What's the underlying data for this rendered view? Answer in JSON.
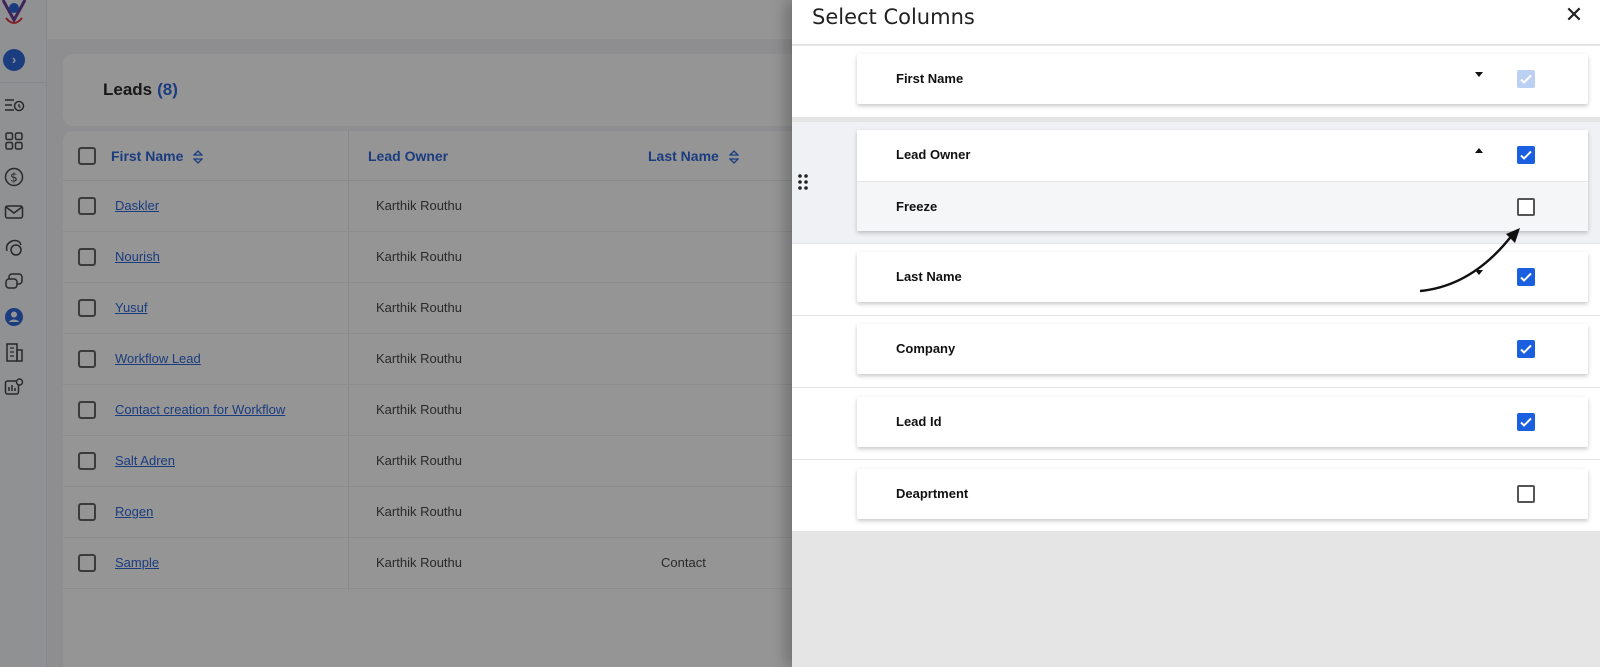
{
  "leads": {
    "title": "Leads",
    "count": "(8)",
    "columns": [
      "First Name",
      "Lead Owner",
      "Last Name"
    ],
    "rows": [
      {
        "first_name": "Daskler",
        "owner": "Karthik Routhu",
        "last_name": ""
      },
      {
        "first_name": "Nourish",
        "owner": "Karthik Routhu",
        "last_name": ""
      },
      {
        "first_name": "Yusuf",
        "owner": "Karthik Routhu",
        "last_name": ""
      },
      {
        "first_name": "Workflow Lead",
        "owner": "Karthik Routhu",
        "last_name": ""
      },
      {
        "first_name": "Contact creation for Workflow",
        "owner": "Karthik Routhu",
        "last_name": ""
      },
      {
        "first_name": "Salt Adren",
        "owner": "Karthik Routhu",
        "last_name": ""
      },
      {
        "first_name": "Rogen",
        "owner": "Karthik Routhu",
        "last_name": ""
      },
      {
        "first_name": "Sample",
        "owner": "Karthik Routhu",
        "last_name": "Contact"
      }
    ]
  },
  "panel": {
    "title": "Select Columns",
    "close": "✕",
    "items": [
      {
        "label": "First Name",
        "caret": "down",
        "checked": "disabled"
      },
      {
        "label": "Lead Owner",
        "caret": "up",
        "checked": "on",
        "sub_label": "Freeze",
        "sub_checked": "off"
      },
      {
        "label": "Last Name",
        "caret": "down",
        "checked": "on"
      },
      {
        "label": "Company",
        "caret": "",
        "checked": "on"
      },
      {
        "label": "Lead Id",
        "caret": "",
        "checked": "on"
      },
      {
        "label": "Deaprtment",
        "caret": "",
        "checked": "off"
      }
    ]
  },
  "colors": {
    "accent": "#1a57d6",
    "checkbox_on": "#1a5fe0",
    "checkbox_disabled": "#bcd0f4"
  },
  "icons": {
    "expand": "chevron-right-icon",
    "sidebar": [
      "lead-history-icon",
      "apps-grid-icon",
      "dollar-icon",
      "mail-icon",
      "chat-bubbles-icon",
      "conversation-icon",
      "user-circle-icon",
      "building-icon",
      "analytics-settings-icon"
    ]
  }
}
